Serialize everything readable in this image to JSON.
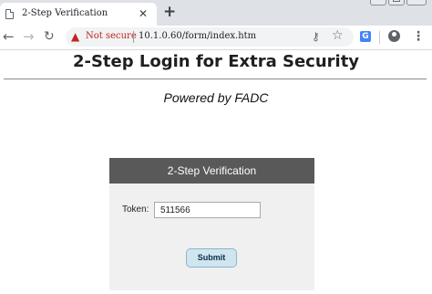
{
  "browser": {
    "tab_title": "2-Step Verification",
    "tab_close": "✕",
    "new_tab": "+",
    "security_label": "Not secure",
    "url": "10.1.0.60/form/index.htm",
    "icons": {
      "back": "arrow-left-icon",
      "forward": "arrow-right-icon",
      "reload": "reload-icon",
      "warning": "warning-triangle-icon",
      "key": "key-icon",
      "bookmark": "star-icon",
      "translate": "translate-icon",
      "account": "account-icon",
      "menu": "kebab-menu-icon"
    }
  },
  "page": {
    "title": "2-Step Login for Extra Security",
    "subtitle": "Powered by FADC"
  },
  "form": {
    "header": "2-Step Verification",
    "token_label": "Token:",
    "token_value": "511566",
    "submit_label": "Submit"
  },
  "colors": {
    "card_header": "#595959",
    "card_body": "#f0f0f0",
    "submit_bg": "#cfe6f0",
    "warning": "#c5221f"
  }
}
